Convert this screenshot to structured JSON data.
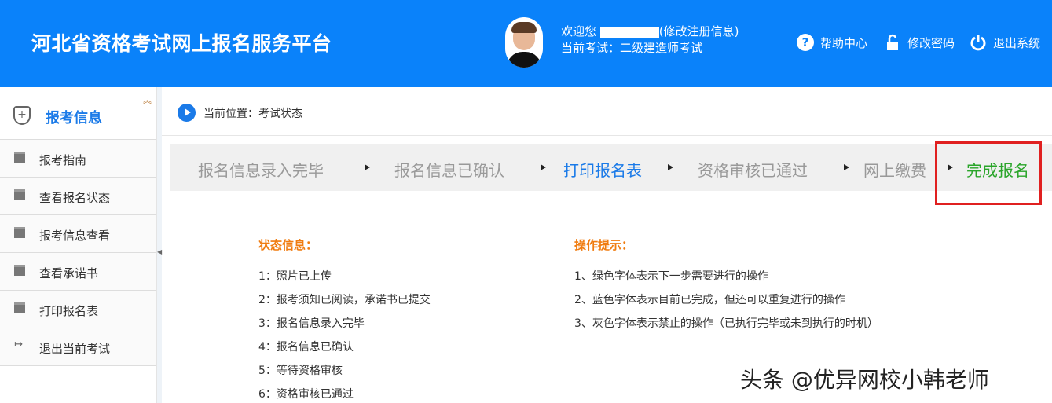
{
  "header": {
    "title": "河北省资格考试网上报名服务平台",
    "welcome_prefix": "欢迎您",
    "edit_info": "(修改注册信息)",
    "current_exam": "当前考试：二级建造师考试",
    "links": [
      {
        "icon": "help-icon",
        "label": "帮助中心"
      },
      {
        "icon": "lock-icon",
        "label": "修改密码"
      },
      {
        "icon": "power-icon",
        "label": "退出系统"
      }
    ]
  },
  "sidebar": {
    "title": "报考信息",
    "items": [
      {
        "label": "报考指南"
      },
      {
        "label": "查看报名状态"
      },
      {
        "label": "报考信息查看"
      },
      {
        "label": "查看承诺书"
      },
      {
        "label": "打印报名表"
      },
      {
        "label": "退出当前考试"
      }
    ]
  },
  "breadcrumb": {
    "text": "当前位置：考试状态"
  },
  "steps": [
    {
      "label": "报名信息录入完毕",
      "state": "gray"
    },
    {
      "label": "报名信息已确认",
      "state": "gray"
    },
    {
      "label": "打印报名表",
      "state": "blue"
    },
    {
      "label": "资格审核已通过",
      "state": "gray"
    },
    {
      "label": "网上缴费",
      "state": "gray"
    },
    {
      "label": "完成报名",
      "state": "green"
    }
  ],
  "colors": {
    "header": "#0a82fa",
    "gray": "#999999",
    "blue": "#1a7ae8",
    "green": "#2aa52a",
    "orange": "#f07c10",
    "highlight": "#e02020"
  },
  "status": {
    "title": "状态信息：",
    "items": [
      "1：照片已上传",
      "2：报考须知已阅读，承诺书已提交",
      "3：报名信息录入完毕",
      "4：报名信息已确认",
      "5：等待资格审核",
      "6：资格审核已通过"
    ]
  },
  "tips": {
    "title": "操作提示：",
    "items": [
      "1、绿色字体表示下一步需要进行的操作",
      "2、蓝色字体表示目前已完成，但还可以重复进行的操作",
      "3、灰色字体表示禁止的操作（已执行完毕或未到执行的时机）"
    ]
  },
  "watermark": "头条 @优异网校小韩老师"
}
